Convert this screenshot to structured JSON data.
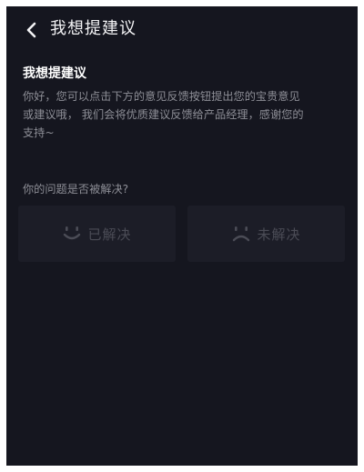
{
  "header": {
    "title": "我想提建议",
    "back_icon": "chevron-left-icon"
  },
  "intro": {
    "title": "我想提建议",
    "description_lines": [
      "你好，您可以点击下方的意见反馈按钮提出您的宝贵意见",
      "或建议哦，  我们会将优质建议反馈给产品经理，感谢您的",
      "支持~"
    ]
  },
  "feedback": {
    "question": "你的问题是否被解决?",
    "options": [
      {
        "label": "已解决",
        "icon": "smile-face-icon"
      },
      {
        "label": "未解决",
        "icon": "sad-face-icon"
      }
    ]
  },
  "colors": {
    "background": "#15161f",
    "card": "#1c1d27",
    "primary_text": "#f2f2f4",
    "secondary_text": "#8d8e96",
    "disabled_text": "#4b4c56"
  }
}
